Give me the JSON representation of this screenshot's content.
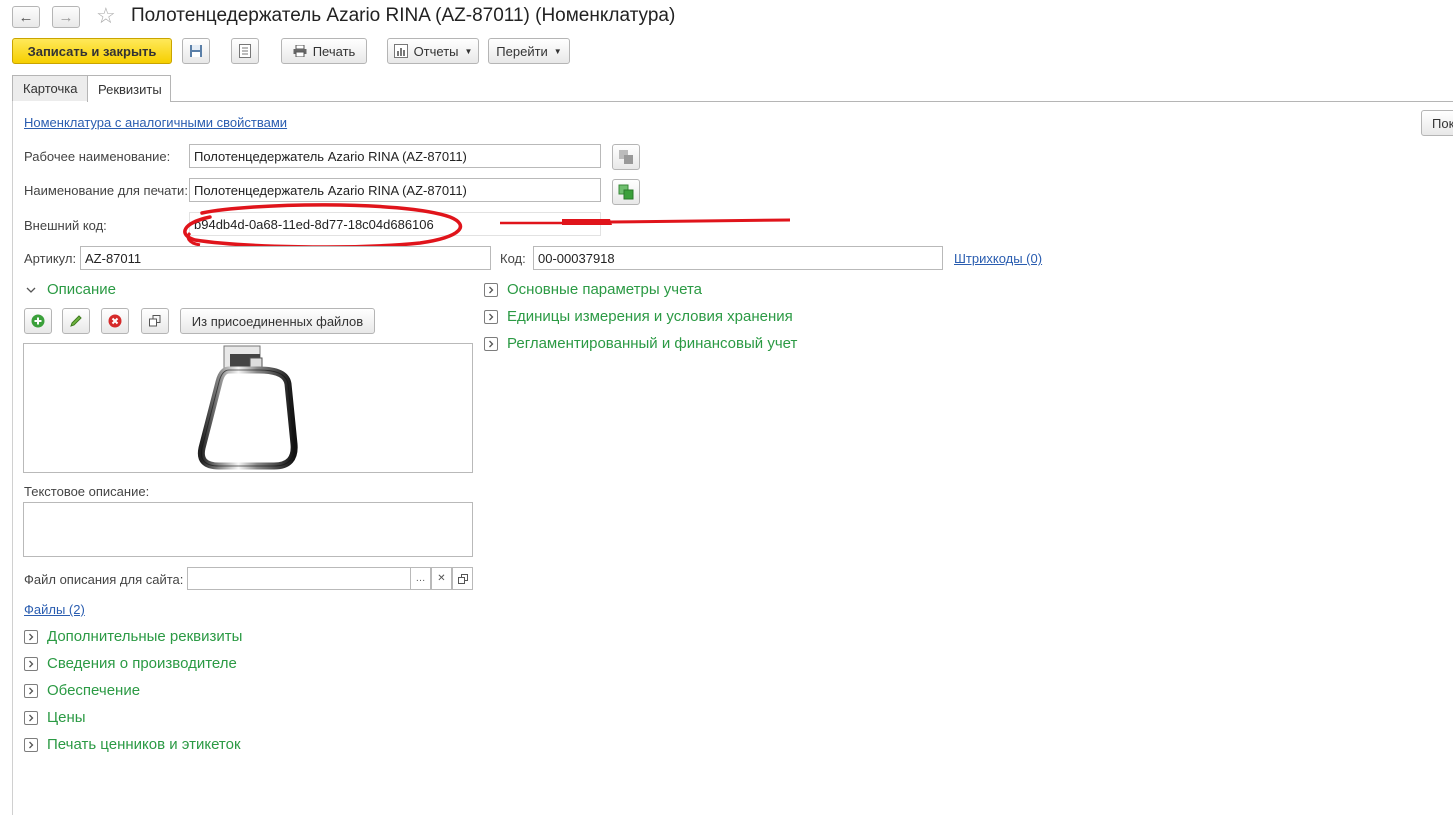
{
  "window": {
    "title": "Полотенцедержатель Azario RINA (AZ-87011) (Номенклатура)"
  },
  "toolbar": {
    "save_close": "Записать и закрыть",
    "print": "Печать",
    "reports": "Отчеты",
    "goto": "Перейти"
  },
  "tabs": [
    {
      "label": "Карточка"
    },
    {
      "label": "Реквизиты"
    }
  ],
  "links": {
    "similar": "Номенклатура с аналогичными свойствами",
    "barcodes": "Штрихкоды (0)",
    "files": "Файлы (2)",
    "right_partial": "Пок"
  },
  "fields": {
    "work_name_label": "Рабочее наименование:",
    "work_name_value": "Полотенцедержатель Azario RINA (AZ-87011)",
    "print_name_label": "Наименование для печати:",
    "print_name_value": "Полотенцедержатель Azario RINA (AZ-87011)",
    "ext_code_label": "Внешний код:",
    "ext_code_value": "b94db4d-0a68-11ed-8d77-18c04d686106",
    "article_label": "Артикул:",
    "article_value": "AZ-87011",
    "code_label": "Код:",
    "code_value": "00-00037918"
  },
  "description": {
    "section": "Описание",
    "from_files": "Из присоединенных файлов",
    "text_label": "Текстовое описание:",
    "site_file_label": "Файл описания для сайта:"
  },
  "right_groups": [
    {
      "label": "Основные параметры учета"
    },
    {
      "label": "Единицы измерения и условия хранения"
    },
    {
      "label": "Регламентированный и финансовый учет"
    }
  ],
  "bottom_groups": [
    {
      "label": "Дополнительные реквизиты"
    },
    {
      "label": "Сведения о производителе"
    },
    {
      "label": "Обеспечение"
    },
    {
      "label": "Цены"
    },
    {
      "label": "Печать ценников и этикеток"
    }
  ],
  "colors": {
    "accent_yellow": "#f6cf00",
    "group_green": "#2b9a44",
    "link_blue": "#2a5db0",
    "annotation_red": "#e0141b"
  }
}
